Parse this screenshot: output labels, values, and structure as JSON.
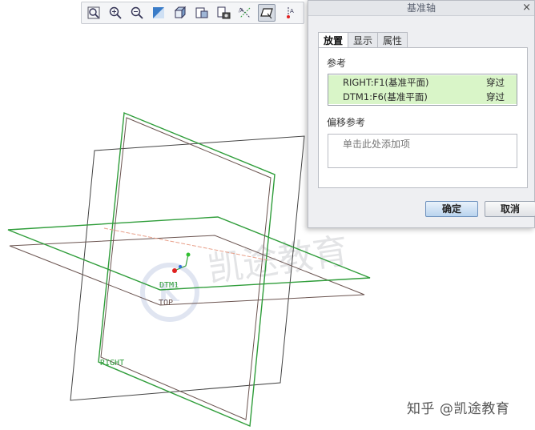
{
  "toolbar": {
    "buttons": [
      {
        "icon": "zoom-fit-icon"
      },
      {
        "icon": "zoom-in-icon"
      },
      {
        "icon": "zoom-out-icon"
      },
      {
        "icon": "repaint-icon"
      },
      {
        "icon": "display-style-icon"
      },
      {
        "icon": "saved-views-icon"
      },
      {
        "icon": "view-manager-icon"
      },
      {
        "icon": "axis-display-icon"
      },
      {
        "icon": "plane-display-icon"
      },
      {
        "icon": "csys-display-icon"
      }
    ],
    "active_icon": "plane-display-icon"
  },
  "viewport": {
    "plane_labels": {
      "dtm1": "DTM1",
      "top": "TOP",
      "right": "RIGHT"
    },
    "colors": {
      "selected_plane": "#2f9d3a",
      "datum_plane": "#6b5450",
      "frame": "#444444"
    }
  },
  "dialog": {
    "title": "基准轴",
    "close": "×",
    "tabs": [
      "放置",
      "显示",
      "属性"
    ],
    "active_tab": "放置",
    "references_label": "参考",
    "references": [
      {
        "name": "RIGHT:F1(基准平面)",
        "constraint": "穿过"
      },
      {
        "name": "DTM1:F6(基准平面)",
        "constraint": "穿过"
      }
    ],
    "offset_label": "偏移参考",
    "offset_placeholder": "单击此处添加项",
    "ok": "确定",
    "cancel": "取消"
  },
  "watermark": {
    "text": "知乎 @凯途教育",
    "logo_text": "凯途教育"
  }
}
